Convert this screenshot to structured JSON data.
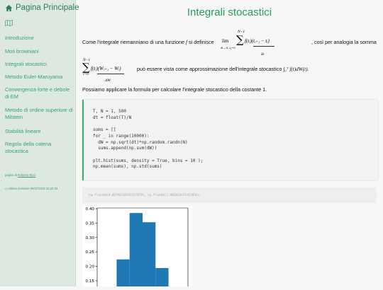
{
  "sidebar": {
    "home_label": "Pagina Principale",
    "items": [
      {
        "label": "Introduzione"
      },
      {
        "label": "Moti browniani"
      },
      {
        "label": "Integrali stocastici"
      },
      {
        "label": "Metodo Euler-Maruyama"
      },
      {
        "label": "Convergenza forte e debole di EM"
      },
      {
        "label": "Metodo di ordine superiore di Milstein"
      },
      {
        "label": "Stabilità lineare"
      },
      {
        "label": "Regola della catena stocastica"
      }
    ],
    "footer_prefix": "pagina di",
    "footer_author": "Roberto Ricci",
    "footer_updated": "Ultima revisione 08/27/2022 15:22:33"
  },
  "main": {
    "title": "Integrali stocastici",
    "para1_before": "Come l'integrale riemanniano di una funzione",
    "para1_f": "f",
    "para1_mid": "si definisce",
    "para1_after": ", così per analogia la somma",
    "para2_after": "può essere vista come approssimazione dell'integrale stocastico",
    "para3": "Possiamo applicare la formula per calcolare l'integrale stocastico della costante 1.",
    "math_lim": "lim",
    "math_lim_sub": "δt→0, t₀=0",
    "math_sum": "∑",
    "math_N1": "N−1",
    "math_i0": "i=0",
    "math_term1": "f(tᵢ)(tᵢ₊₁ − tᵢ)",
    "math_dt": "δt",
    "math_term2": "f(tᵢ)(Wᵢ₊₁ − Wᵢ)",
    "math_dW": "ΔW",
    "math_integral": "∫₀ᵀ f(t)dW(t).",
    "code": "T, N = 1, 500\ndt = float(T)/N\n\nsums = []\nfor _ in range(10000):\n  dW = np.sqrt(dt)*np.random.randn(N)\n  sums.append(np.sum(dW))\n\nplt.hist(sums, density = True, bins = 10 );\nnp.mean(sums), np.std(sums)",
    "output": "(np.float64(0.007901203932225979), np.float64(1.0003626474427056))"
  },
  "chart_data": {
    "type": "bar",
    "ylim": [
      0.13,
      0.41
    ],
    "yticks": [
      "0.40",
      "0.35",
      "0.30",
      "0.25",
      "0.20",
      "0.15"
    ],
    "bars": [
      {
        "x0": 0.0,
        "x1": 1.0,
        "value": 0.224
      },
      {
        "x0": 1.0,
        "x1": 2.0,
        "value": 0.385
      },
      {
        "x0": 2.0,
        "x1": 3.0,
        "value": 0.353
      },
      {
        "x0": 3.0,
        "x1": 4.0,
        "value": 0.194
      }
    ],
    "bar_color": "#1f77b4",
    "grid": false
  }
}
